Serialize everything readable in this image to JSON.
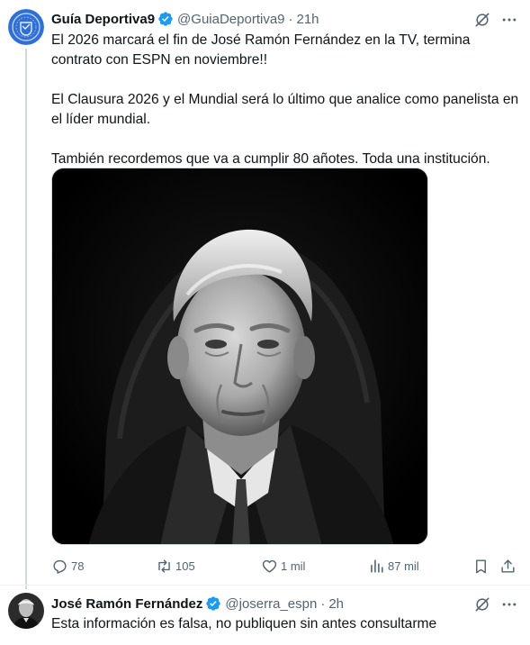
{
  "tweet": {
    "author_name": "Guía Deportiva9",
    "handle": "@GuiaDeportiva9",
    "separator": "·",
    "time": "21h",
    "paragraphs": [
      "El 2026 marcará el fin de José Ramón Fernández en la TV, termina contrato con ESPN en noviembre!!",
      "El Clausura 2026 y el Mundial será lo último que analice como panelista en el líder mundial.",
      "También recordemos que va a cumplir 80 añotes. Toda una institución."
    ],
    "stats": {
      "replies": "78",
      "reposts": "105",
      "likes": "1 mil",
      "views": "87 mil"
    }
  },
  "reply": {
    "author_name": "José Ramón Fernández",
    "handle": "@joserra_espn",
    "separator": "·",
    "time": "2h",
    "text": "Esta información es falsa, no publiquen sin antes consultarme"
  },
  "icons": {
    "verified": "verified-badge-icon",
    "grok": "grok-icon",
    "more": "more-dots-icon",
    "reply": "reply-icon",
    "repost": "repost-icon",
    "like": "heart-icon",
    "views": "views-bar-icon",
    "bookmark": "bookmark-icon",
    "share": "share-icon"
  },
  "colors": {
    "verified_blue": "#1d9bf0",
    "secondary_text": "#536471",
    "primary_text": "#0f1419",
    "avatar_blue": "#2f6fd6"
  }
}
